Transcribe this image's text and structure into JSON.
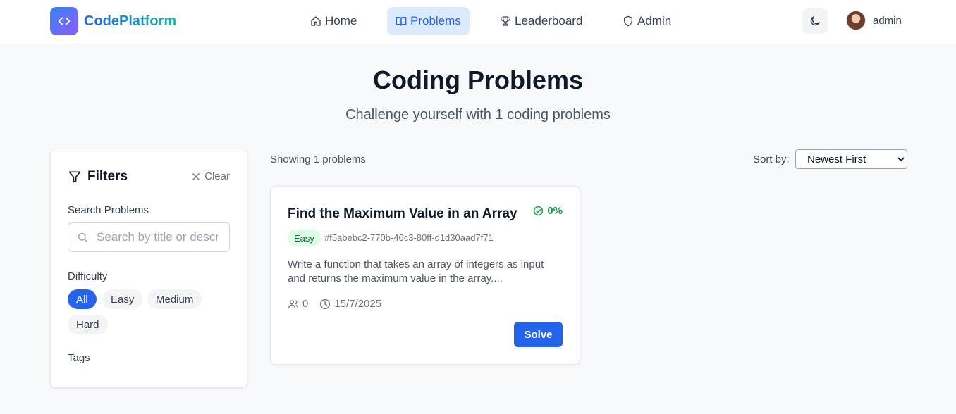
{
  "brand": {
    "name": "CodePlatform",
    "logo_icon": "code-brackets-icon",
    "gradient": [
      "#3b82f6",
      "#8b5cf6"
    ]
  },
  "nav": {
    "items": [
      {
        "label": "Home",
        "icon": "home-icon"
      },
      {
        "label": "Problems",
        "icon": "book-icon",
        "active": true
      },
      {
        "label": "Leaderboard",
        "icon": "trophy-icon"
      },
      {
        "label": "Admin",
        "icon": "shield-icon"
      }
    ],
    "theme_icon": "moon-icon",
    "user": {
      "name": "admin"
    }
  },
  "hero": {
    "title": "Coding Problems",
    "subtitle": "Challenge yourself with 1 coding problems"
  },
  "filters": {
    "title": "Filters",
    "clear_label": "Clear",
    "search_label": "Search Problems",
    "search_placeholder": "Search by title or description...",
    "difficulty_label": "Difficulty",
    "difficulty_options": [
      "All",
      "Easy",
      "Medium",
      "Hard"
    ],
    "difficulty_selected": "All",
    "tags_label": "Tags"
  },
  "results": {
    "showing": "Showing 1 problems",
    "sort_label": "Sort by:",
    "sort_selected": "Newest First"
  },
  "problems": [
    {
      "title": "Find the Maximum Value in an Array",
      "acceptance": "0%",
      "difficulty": "Easy",
      "id": "#f5abebc2-770b-46c3-80ff-d1d30aad7f71",
      "description": "Write a function that takes an array of integers as input and returns the maximum value in the array....",
      "submissions": "0",
      "date": "15/7/2025",
      "solve_label": "Solve"
    }
  ],
  "colors": {
    "accent": "#2563eb",
    "success": "#16a34a",
    "easy_bg": "#dcfce7"
  }
}
